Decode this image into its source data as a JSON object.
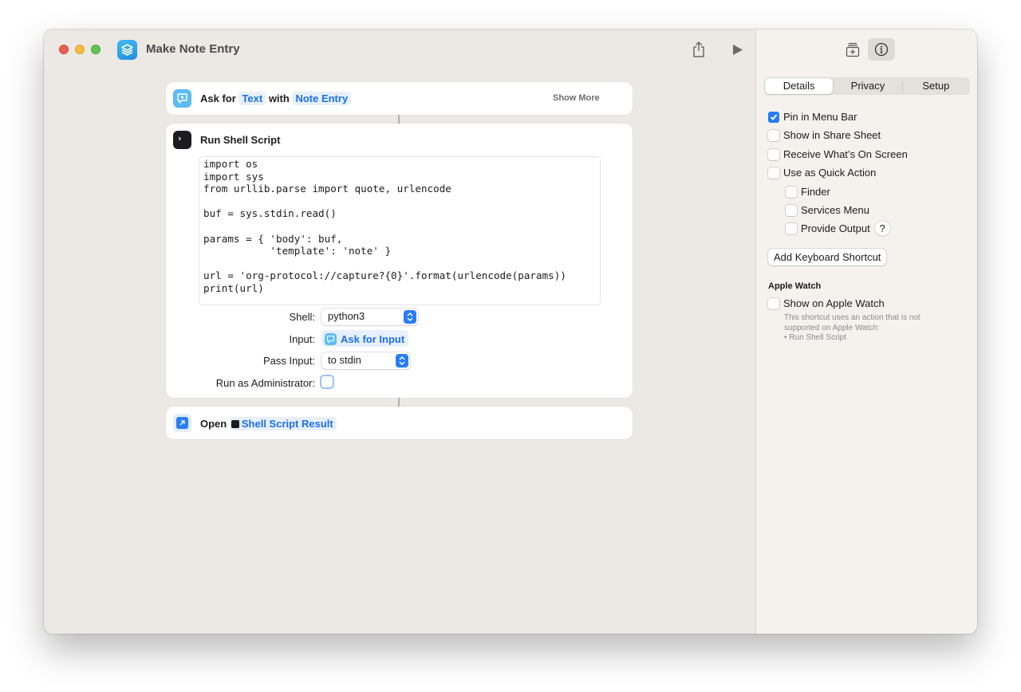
{
  "window": {
    "title": "Make Note Entry"
  },
  "toolbar": {
    "share_icon": "share-icon",
    "run_icon": "play-icon"
  },
  "actions": {
    "ask": {
      "verb": "Ask for",
      "type_token": "Text",
      "with": "with",
      "prompt_token": "Note Entry",
      "show_more": "Show More"
    },
    "shell": {
      "title": "Run Shell Script",
      "code_lines": [
        "import os",
        "import sys",
        "from urllib.parse import quote, urlencode",
        "",
        "buf = sys.stdin.read()",
        "",
        "params = { 'body': buf,",
        "           'template': 'note' }",
        "",
        "url = 'org-protocol://capture?{0}'.format(urlencode(params))",
        "print(url)"
      ],
      "shell_label": "Shell:",
      "shell_value": "python3",
      "input_label": "Input:",
      "input_value": "Ask for Input",
      "pass_input_label": "Pass Input:",
      "pass_input_value": "to stdin",
      "run_as_admin_label": "Run as Administrator:",
      "run_as_admin": false
    },
    "open": {
      "verb": "Open",
      "token": "Shell Script Result"
    }
  },
  "sidebar": {
    "tabs": [
      "Details",
      "Privacy",
      "Setup"
    ],
    "active_tab": "Details",
    "options": [
      {
        "label": "Pin in Menu Bar",
        "checked": true
      },
      {
        "label": "Show in Share Sheet",
        "checked": false
      },
      {
        "label": "Receive What’s On Screen",
        "checked": false
      },
      {
        "label": "Use as Quick Action",
        "checked": false
      }
    ],
    "quick_action_options": [
      {
        "label": "Finder",
        "checked": false
      },
      {
        "label": "Services Menu",
        "checked": false
      },
      {
        "label": "Provide Output",
        "checked": false
      }
    ],
    "help_label": "?",
    "keyboard_shortcut_button": "Add Keyboard Shortcut",
    "apple_watch": {
      "heading": "Apple Watch",
      "option_label": "Show on Apple Watch",
      "checked": false,
      "note_line1": "This shortcut uses an action that is not",
      "note_line2": "supported on Apple Watch:",
      "note_line3": "• Run Shell Script"
    }
  },
  "colors": {
    "accent": "#2a7cf6",
    "token_text": "#1b6ff3",
    "token_bg": "#e8f0fd",
    "window_bg": "#ece8e3",
    "sidebar_bg": "#f5f2ee"
  }
}
